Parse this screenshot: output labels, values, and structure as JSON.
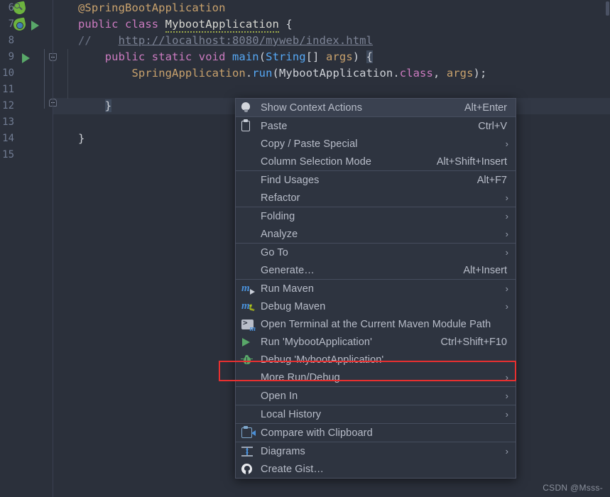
{
  "editor": {
    "line_numbers": [
      "6",
      "7",
      "8",
      "9",
      "10",
      "11",
      "12",
      "13",
      "14",
      "15"
    ],
    "code_lines": [
      {
        "n": "6",
        "text": "@SpringBootApplication"
      },
      {
        "n": "7",
        "text": "public class MybootApplication {"
      },
      {
        "n": "8",
        "text": "//    http://localhost:8080/myweb/index.html"
      },
      {
        "n": "9",
        "text": "    public static void main(String[] args) {"
      },
      {
        "n": "10",
        "text": "        SpringApplication.run(MybootApplication.class, args);"
      },
      {
        "n": "11",
        "text": ""
      },
      {
        "n": "12",
        "text": "    }"
      },
      {
        "n": "13",
        "text": ""
      },
      {
        "n": "14",
        "text": "}"
      },
      {
        "n": "15",
        "text": ""
      }
    ],
    "tokens": {
      "annotation": "@SpringBootApplication",
      "kw_public": "public",
      "kw_class": "class",
      "class_name": "MybootApplication",
      "brace_open": "{",
      "comment_slashes": "//",
      "comment_url": "http://localhost:8080/myweb/index.html",
      "kw_static": "static",
      "kw_void": "void",
      "method_main": "main",
      "type_string": "String",
      "brackets": "[]",
      "param_args": "args",
      "call_owner": "SpringApplication",
      "call_method": "run",
      "arg_class_name": "MybootApplication",
      "kw_class_literal": "class",
      "arg_args": "args",
      "brace_close": "}"
    },
    "colors": {
      "background": "#2b303b",
      "current_line": "#323845",
      "gutter_text": "#717c93",
      "annotation": "#c9a26d",
      "keyword": "#cc7bc0",
      "comment": "#6b7385",
      "method": "#56a8f5",
      "plain": "#cfd2d8"
    }
  },
  "context_menu": {
    "groups": [
      {
        "items": [
          {
            "label": "Show Context Actions",
            "shortcut": "Alt+Enter",
            "icon": "lightbulb-icon",
            "arrow": false,
            "hovered": true,
            "mnemonic": ""
          }
        ]
      },
      {
        "items": [
          {
            "label": "Paste",
            "shortcut": "Ctrl+V",
            "icon": "clipboard-icon",
            "arrow": false,
            "hovered": false,
            "mnemonic": "P"
          },
          {
            "label": "Copy / Paste Special",
            "shortcut": "",
            "icon": "",
            "arrow": true,
            "hovered": false,
            "mnemonic": ""
          },
          {
            "label": "Column Selection Mode",
            "shortcut": "Alt+Shift+Insert",
            "icon": "",
            "arrow": false,
            "hovered": false,
            "mnemonic": "M"
          }
        ]
      },
      {
        "items": [
          {
            "label": "Find Usages",
            "shortcut": "Alt+F7",
            "icon": "",
            "arrow": false,
            "hovered": false,
            "mnemonic": "U"
          },
          {
            "label": "Refactor",
            "shortcut": "",
            "icon": "",
            "arrow": true,
            "hovered": false,
            "mnemonic": "R"
          }
        ]
      },
      {
        "items": [
          {
            "label": "Folding",
            "shortcut": "",
            "icon": "",
            "arrow": true,
            "hovered": false,
            "mnemonic": ""
          },
          {
            "label": "Analyze",
            "shortcut": "",
            "icon": "",
            "arrow": true,
            "hovered": false,
            "mnemonic": "z"
          }
        ]
      },
      {
        "items": [
          {
            "label": "Go To",
            "shortcut": "",
            "icon": "",
            "arrow": true,
            "hovered": false,
            "mnemonic": ""
          },
          {
            "label": "Generate…",
            "shortcut": "Alt+Insert",
            "icon": "",
            "arrow": false,
            "hovered": false,
            "mnemonic": ""
          }
        ]
      },
      {
        "items": [
          {
            "label": "Run Maven",
            "shortcut": "",
            "icon": "maven-run-icon",
            "arrow": true,
            "hovered": false,
            "mnemonic": ""
          },
          {
            "label": "Debug Maven",
            "shortcut": "",
            "icon": "maven-debug-icon",
            "arrow": true,
            "hovered": false,
            "mnemonic": ""
          },
          {
            "label": "Open Terminal at the Current Maven Module Path",
            "shortcut": "",
            "icon": "terminal-icon",
            "arrow": false,
            "hovered": false,
            "mnemonic": ""
          },
          {
            "label": "Run 'MybootApplication'",
            "shortcut": "Ctrl+Shift+F10",
            "icon": "run-play-icon",
            "arrow": false,
            "hovered": false,
            "mnemonic": "u"
          },
          {
            "label": "Debug 'MybootApplication'",
            "shortcut": "",
            "icon": "debug-bug-icon",
            "arrow": false,
            "hovered": false,
            "mnemonic": "D",
            "highlighted": true
          },
          {
            "label": "More Run/Debug",
            "shortcut": "",
            "icon": "",
            "arrow": true,
            "hovered": false,
            "mnemonic": ""
          }
        ]
      },
      {
        "items": [
          {
            "label": "Open In",
            "shortcut": "",
            "icon": "",
            "arrow": true,
            "hovered": false,
            "mnemonic": ""
          }
        ]
      },
      {
        "items": [
          {
            "label": "Local History",
            "shortcut": "",
            "icon": "",
            "arrow": true,
            "hovered": false,
            "mnemonic": "H"
          }
        ]
      },
      {
        "items": [
          {
            "label": "Compare with Clipboard",
            "shortcut": "",
            "icon": "compare-clipboard-icon",
            "arrow": false,
            "hovered": false,
            "mnemonic": "b"
          }
        ]
      },
      {
        "items": [
          {
            "label": "Diagrams",
            "shortcut": "",
            "icon": "diagram-icon",
            "arrow": true,
            "hovered": false,
            "mnemonic": ""
          },
          {
            "label": "Create Gist…",
            "shortcut": "",
            "icon": "github-icon",
            "arrow": false,
            "hovered": false,
            "mnemonic": ""
          }
        ]
      }
    ],
    "highlight_color": "#e83030"
  },
  "watermark": {
    "text": "CSDN @Msss-"
  }
}
